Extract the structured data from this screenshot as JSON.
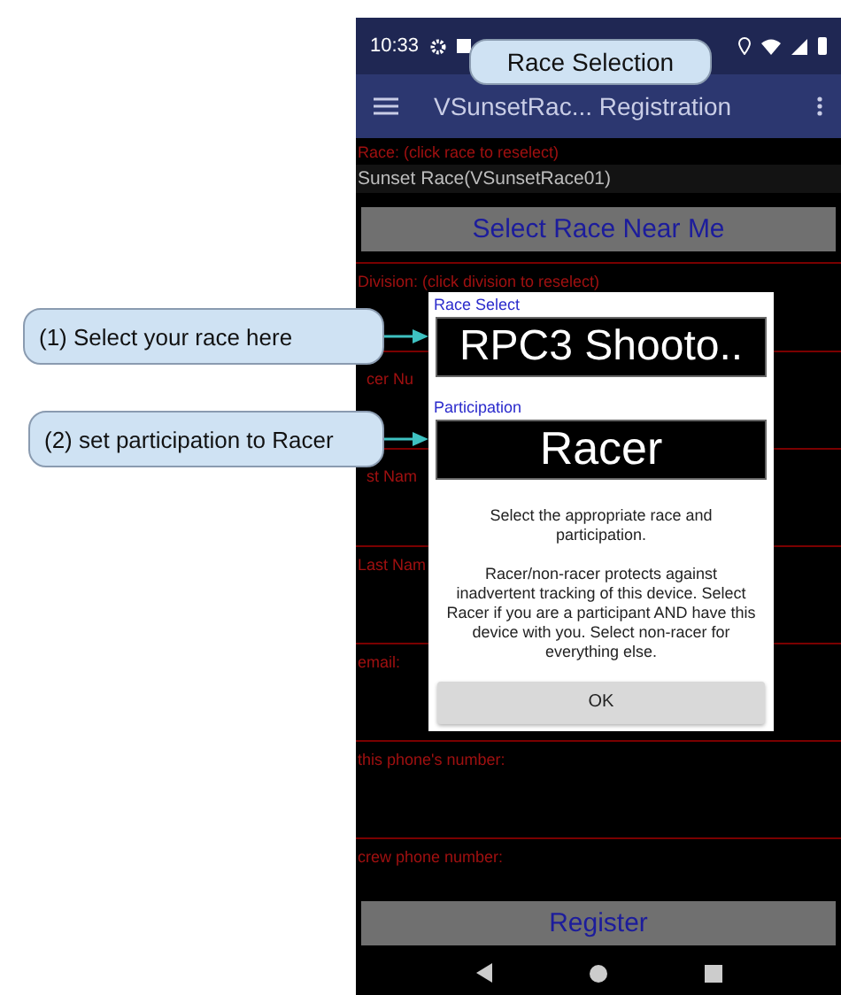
{
  "status_bar": {
    "time": "10:33"
  },
  "title_callout": "Race Selection",
  "app_bar": {
    "title": "VSunsetRac... Registration"
  },
  "form": {
    "race_label": "Race: (click race to reselect)",
    "race_value": "Sunset Race(VSunsetRace01)",
    "select_button": "Select Race Near Me",
    "fields": [
      {
        "label": "Division: (click division to reselect)"
      },
      {
        "label": "cer Nu"
      },
      {
        "label": "st Nam"
      },
      {
        "label": "Last Nam"
      },
      {
        "label": "email:"
      },
      {
        "label": "this phone's number:"
      },
      {
        "label": "crew phone number:"
      }
    ],
    "register_button": "Register"
  },
  "dialog": {
    "race_heading": "Race Select",
    "race_value": "RPC3 Shooto..",
    "participation_heading": "Participation",
    "participation_value": "Racer",
    "paragraphs": [
      "Select the appropriate race and participation.",
      "Racer/non-racer protects against inadvertent tracking of this device. Select Racer if you are a participant AND have this device with you. Select non-racer for everything else."
    ],
    "ok_button": "OK"
  },
  "annotations": [
    {
      "text": "(1) Select your race here"
    },
    {
      "text": "(2) set participation to Racer"
    }
  ]
}
